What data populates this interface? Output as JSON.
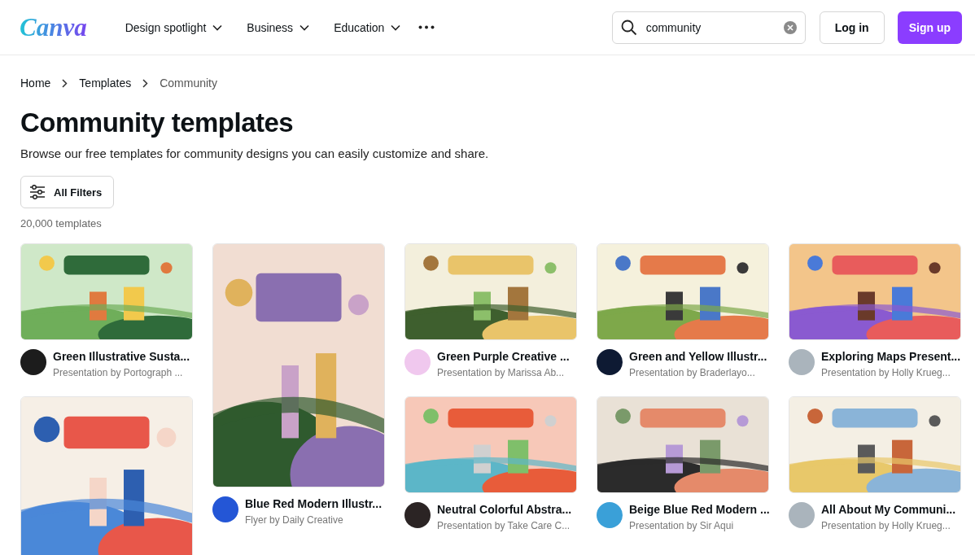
{
  "header": {
    "logo": "Canva",
    "menu": [
      {
        "label": "Design spotlight"
      },
      {
        "label": "Business"
      },
      {
        "label": "Education"
      }
    ],
    "search": {
      "value": "community"
    },
    "login": "Log in",
    "signup": "Sign up"
  },
  "breadcrumb": [
    {
      "label": "Home"
    },
    {
      "label": "Templates"
    },
    {
      "label": "Community"
    }
  ],
  "title": "Community templates",
  "subtitle": "Browse our free templates for community designs you can easily customize and share.",
  "filters_button": "All Filters",
  "count": "20,000 templates",
  "columns": [
    [
      {
        "kind": "wide",
        "title": "Green Illustrative Susta...",
        "author": "Presentation by Portograph ...",
        "color": "#1c1c1c"
      },
      {
        "kind": "tall"
      }
    ],
    [
      {
        "kind": "flyer",
        "title": "Blue Red Modern Illustr...",
        "author": "Flyer by Daily Creative",
        "color": "#2456d6"
      }
    ],
    [
      {
        "kind": "wide",
        "title": "Green Purple Creative ...",
        "author": "Presentation by Marissa Ab...",
        "color": "#f0c8ee"
      },
      {
        "kind": "wide",
        "title": "Neutral Colorful Abstra...",
        "author": "Presentation by Take Care C...",
        "color": "#2b2424"
      }
    ],
    [
      {
        "kind": "wide",
        "title": "Green and Yellow Illustr...",
        "author": "Presentation by Braderlayo...",
        "color": "#0e1a33"
      },
      {
        "kind": "wide",
        "title": "Beige Blue Red Modern ...",
        "author": "Presentation by Sir Aqui",
        "color": "#3aa0d8"
      }
    ],
    [
      {
        "kind": "wide",
        "title": "Exploring Maps Present...",
        "author": "Presentation by Holly Krueg...",
        "color": "#aab4bc"
      },
      {
        "kind": "wide",
        "title": "All About My Communi...",
        "author": "Presentation by Holly Krueg...",
        "color": "#aab4bc"
      }
    ]
  ]
}
